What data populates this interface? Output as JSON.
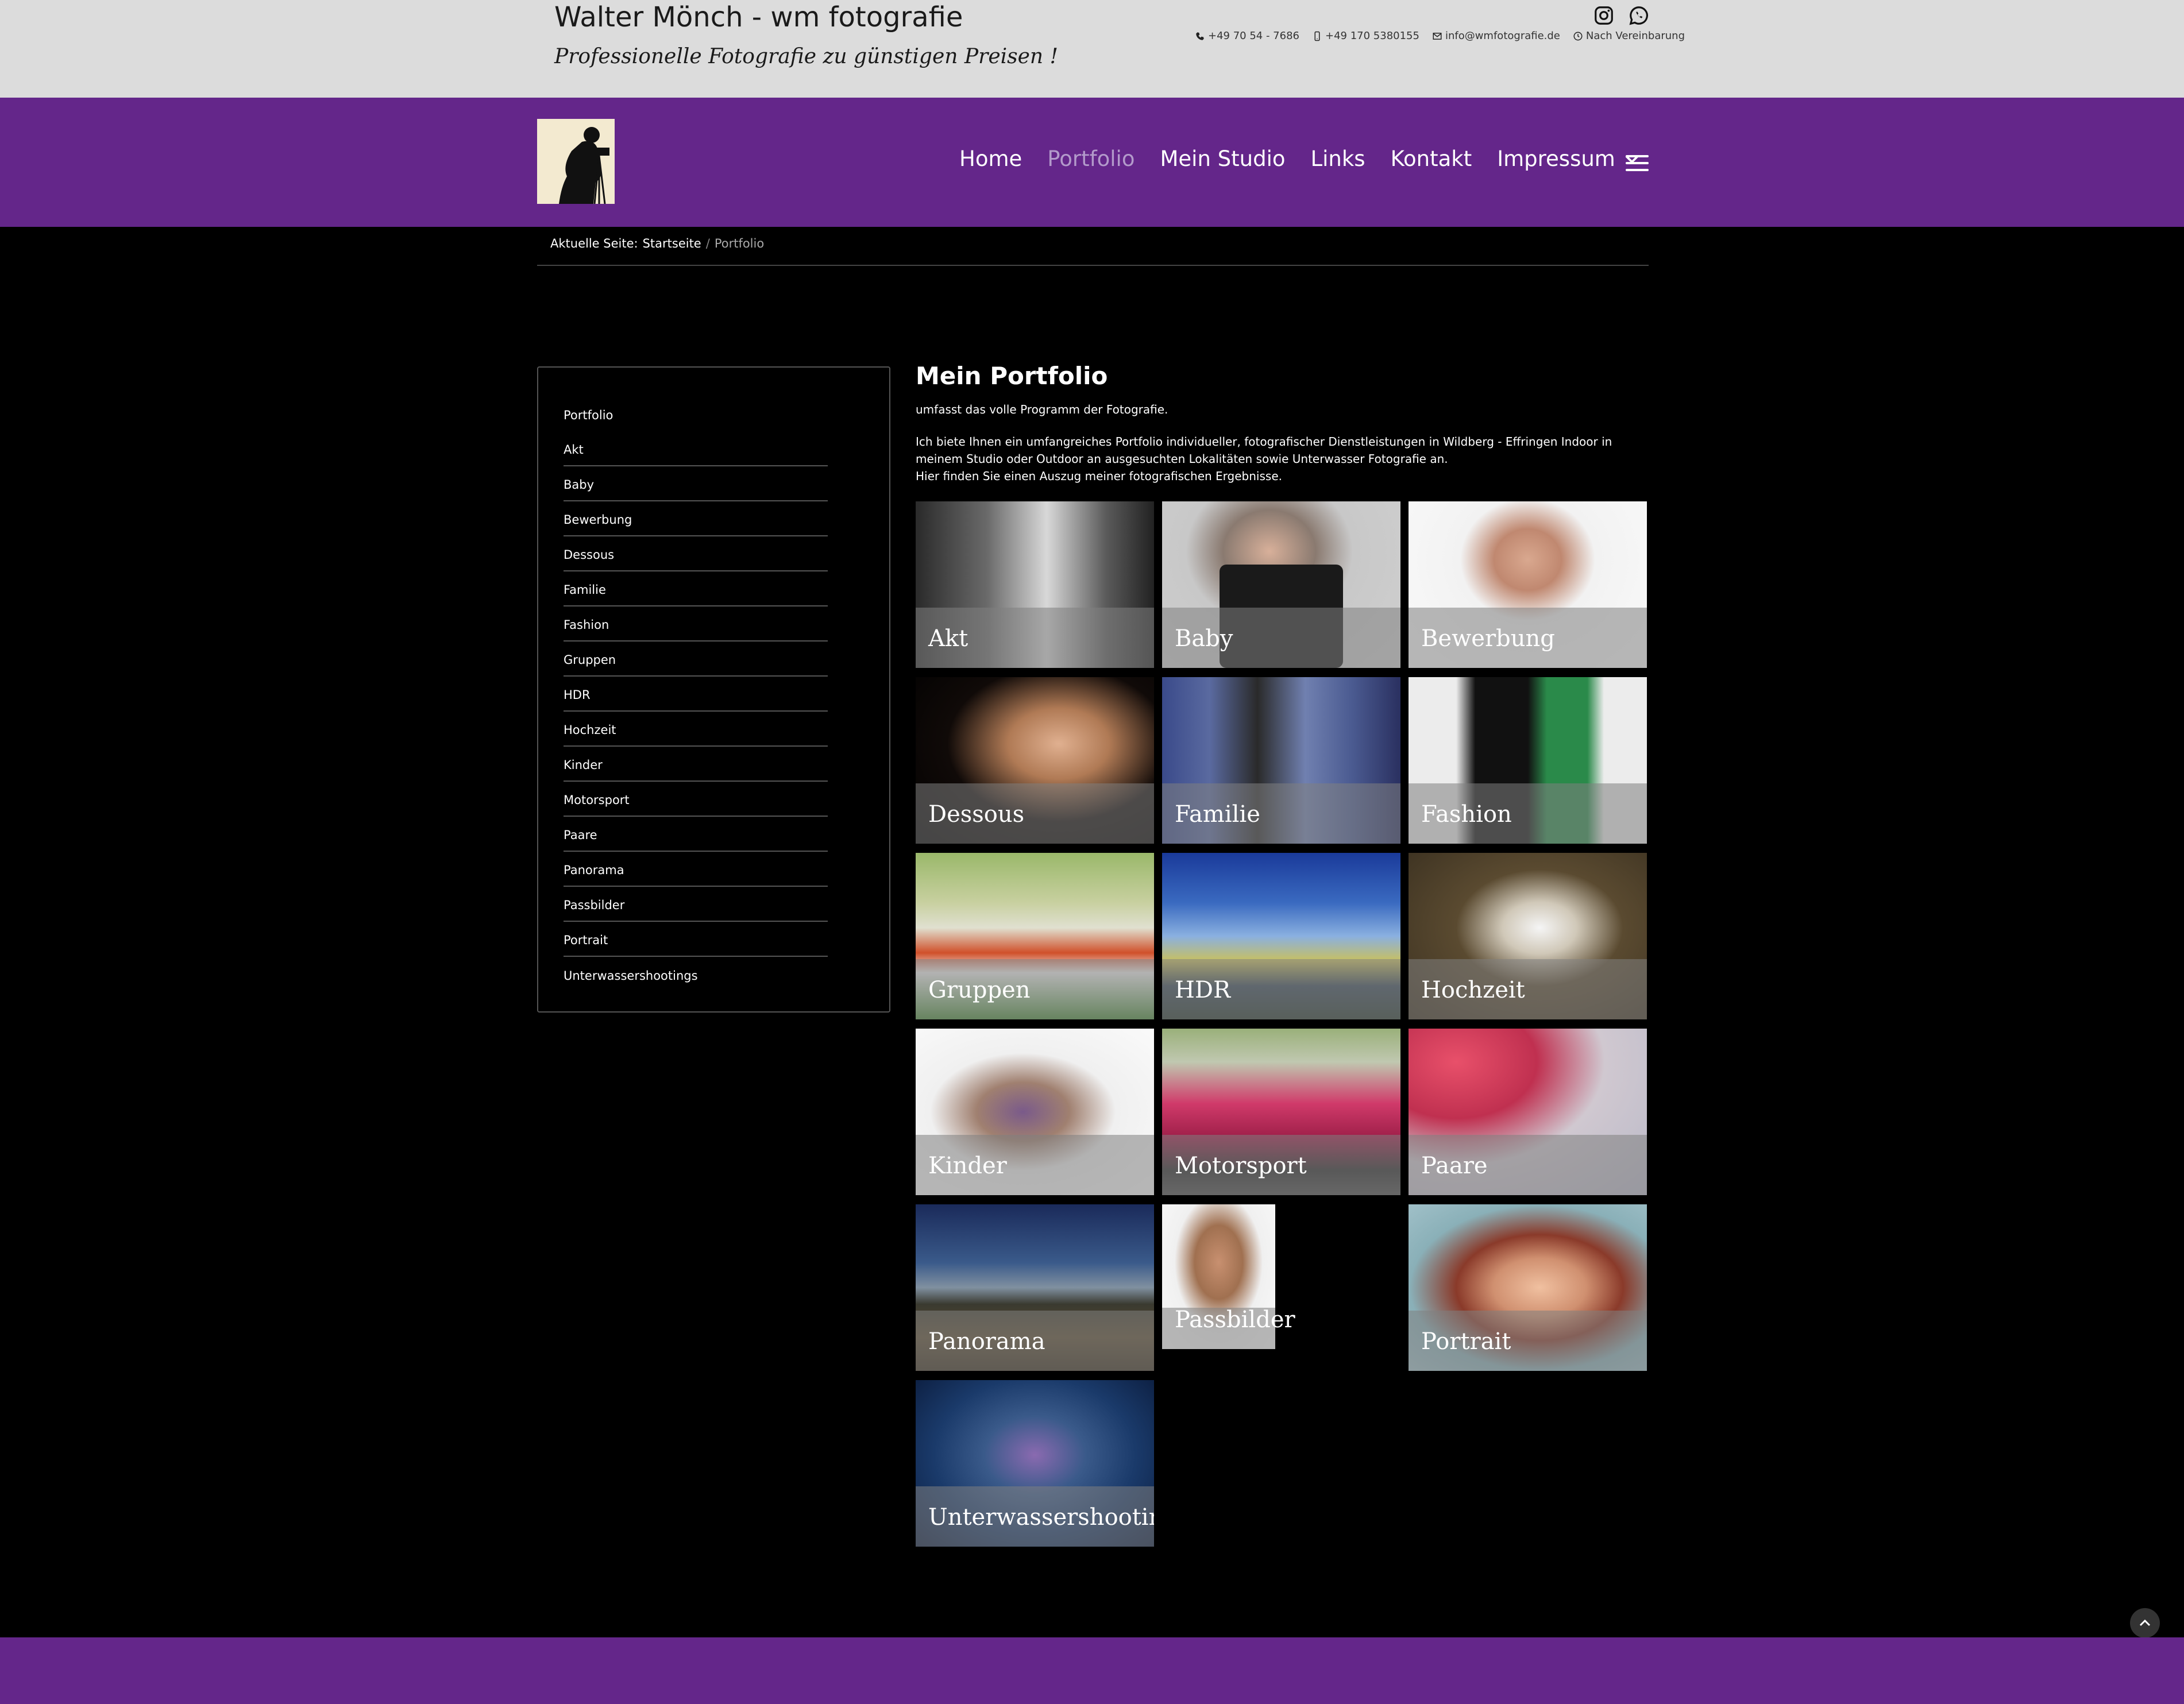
{
  "header": {
    "site_title": "Walter Mönch - wm fotografie",
    "slogan": "Professionelle Fotografie zu günstigen Preisen !",
    "contact": {
      "phone": "+49 70 54 - 7686",
      "mobile": "+49 170 5380155",
      "email": "info@wmfotografie.de",
      "hours": "Nach Vereinbarung"
    },
    "social": [
      "instagram-icon",
      "whatsapp-icon"
    ]
  },
  "nav": {
    "items": [
      {
        "label": "Home"
      },
      {
        "label": "Portfolio",
        "active": true
      },
      {
        "label": "Mein Studio"
      },
      {
        "label": "Links"
      },
      {
        "label": "Kontakt"
      },
      {
        "label": "Impressum",
        "dropdown": true
      }
    ],
    "bg_color": "#64268a",
    "active_color": "#b39acb"
  },
  "breadcrumb": {
    "prefix": "Aktuelle Seite:",
    "home": "Startseite",
    "separator": "/",
    "current": "Portfolio"
  },
  "sidebar": {
    "items": [
      "Portfolio",
      "Akt",
      "Baby",
      "Bewerbung",
      "Dessous",
      "Familie",
      "Fashion",
      "Gruppen",
      "HDR",
      "Hochzeit",
      "Kinder",
      "Motorsport",
      "Paare",
      "Panorama",
      "Passbilder",
      "Portrait",
      "Unterwassershootings"
    ]
  },
  "main": {
    "title": "Mein Portfolio",
    "intro_1": "umfasst das volle Programm der Fotografie.",
    "intro_2": "Ich biete Ihnen ein umfangreiches Portfolio individueller, fotografischer Dienstleistungen in Wildberg - Effringen Indoor in meinem Studio oder Outdoor an ausgesuchten Lokalitäten sowie Unterwasser Fotografie an.",
    "intro_3": "Hier finden Sie einen Auszug meiner fotografischen Ergebnisse."
  },
  "gallery": [
    {
      "label": "Akt"
    },
    {
      "label": "Baby"
    },
    {
      "label": "Bewerbung"
    },
    {
      "label": "Dessous"
    },
    {
      "label": "Familie"
    },
    {
      "label": "Fashion"
    },
    {
      "label": "Gruppen"
    },
    {
      "label": "HDR"
    },
    {
      "label": "Hochzeit"
    },
    {
      "label": "Kinder"
    },
    {
      "label": "Motorsport"
    },
    {
      "label": "Paare"
    },
    {
      "label": "Panorama"
    },
    {
      "label": "Passbilder"
    },
    {
      "label": "Portrait"
    },
    {
      "label": "Unterwassershootings"
    }
  ]
}
